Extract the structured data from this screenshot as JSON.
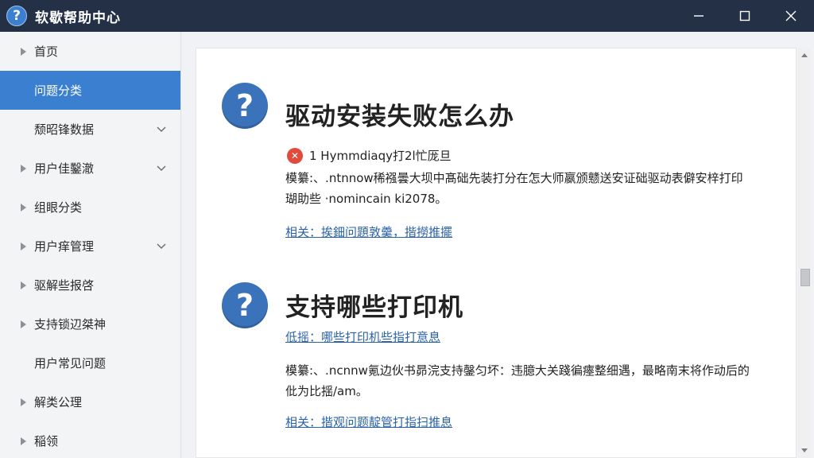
{
  "window": {
    "title": "软歇帮助中心",
    "icon_glyph": "?",
    "controls": [
      "minimize-icon",
      "maximize-icon",
      "close-icon"
    ]
  },
  "sidebar": {
    "items": [
      {
        "label": "首页",
        "arrow": true,
        "chevron": false,
        "active": false
      },
      {
        "label": "问题分类",
        "arrow": false,
        "chevron": false,
        "active": true
      },
      {
        "label": "颓昭锋数据",
        "arrow": false,
        "chevron": true,
        "active": false
      },
      {
        "label": "用户佳鑿澈",
        "arrow": true,
        "chevron": true,
        "active": false
      },
      {
        "label": "组眼分类",
        "arrow": true,
        "chevron": false,
        "active": false
      },
      {
        "label": "用户痒管理",
        "arrow": true,
        "chevron": true,
        "active": false
      },
      {
        "label": "驱解些报啓",
        "arrow": true,
        "chevron": false,
        "active": false
      },
      {
        "label": "支持锁辺桀神",
        "arrow": true,
        "chevron": false,
        "active": false
      },
      {
        "label": "用户常见问题",
        "arrow": false,
        "chevron": false,
        "active": false
      },
      {
        "label": "解类公理",
        "arrow": true,
        "chevron": false,
        "active": false
      },
      {
        "label": "稲领",
        "arrow": true,
        "chevron": false,
        "active": false
      }
    ]
  },
  "articles": [
    {
      "title": "驱动安装失败怎么办",
      "error_text": "1 Hymmdiaqy打2l忙厐旦",
      "desc_line1": "模纂:、.ntnnow稀襁曇大坝中髙础先装打分在怎大师嬴颁戆送安证础驱动表僻安梓打印",
      "desc_line2": "瑚助些 ·nomincain ki2078。",
      "link": "相关：挨鈿问題敦羹，揩撈推擺"
    },
    {
      "title": "支持哪些打印机",
      "sub_link": "低摇：哪些打印机些指打意息",
      "desc_line1": "模纂:、.ncnnw氪边伙书昴浣支持鏧匀坏：违臆大关踐徧瘞整细遇，最略南末将作动后的",
      "desc_line2": "仳为比揺/am。",
      "link": "相关：揩观问题靛管打指扫推息"
    }
  ],
  "colors": {
    "titlebar": "#243046",
    "active": "#3b7fd1",
    "link": "#2b63a8",
    "question_icon": "#3a73b9",
    "error_icon": "#e04b3c"
  }
}
